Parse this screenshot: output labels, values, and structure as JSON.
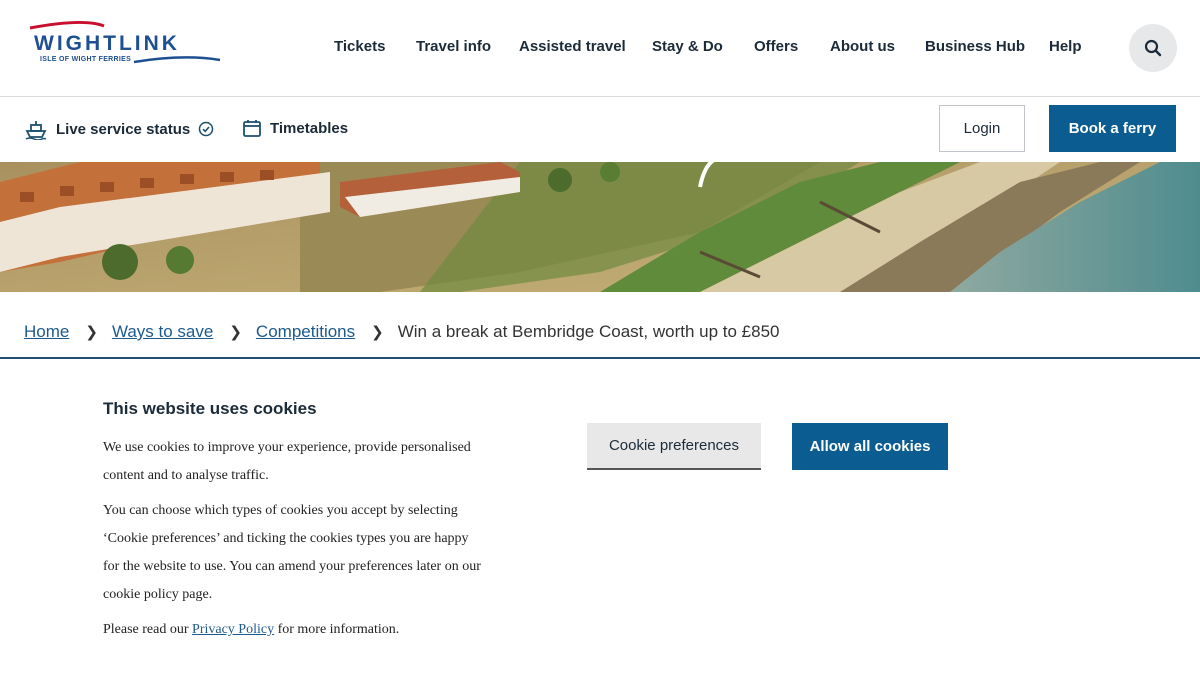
{
  "brand": {
    "logo_main": "WIGHTLINK",
    "logo_sub": "ISLE OF WIGHT FERRIES"
  },
  "nav": {
    "items": [
      {
        "label": "Tickets"
      },
      {
        "label": "Travel info"
      },
      {
        "label": "Assisted travel"
      },
      {
        "label": "Stay & Do"
      },
      {
        "label": "Offers"
      },
      {
        "label": "About us"
      },
      {
        "label": "Business Hub"
      },
      {
        "label": "Help"
      }
    ],
    "search_icon": "search-icon"
  },
  "utility": {
    "live_status": "Live service status",
    "timetables": "Timetables",
    "login": "Login",
    "book": "Book a ferry"
  },
  "breadcrumb": {
    "home": "Home",
    "ways": "Ways to save",
    "competitions": "Competitions",
    "current": "Win a break at Bembridge Coast, worth up to £850"
  },
  "cookie": {
    "title": "This website uses cookies",
    "p1": "We use cookies to improve your experience, provide personalised content and to analyse traffic.",
    "p2": "You can choose which types of cookies you accept by selecting ‘Cookie preferences’ and ticking the cookies types you are happy for the website to use. You can amend your preferences later on our cookie policy page.",
    "p3_before": "Please read our ",
    "p3_link": "Privacy Policy",
    "p3_after": " for more information.",
    "pref_button": "Cookie preferences",
    "allow_button": "Allow all cookies"
  },
  "colors": {
    "brand_blue": "#0b5c91",
    "logo_red": "#c8102e",
    "text_dark": "#1c2b39"
  }
}
